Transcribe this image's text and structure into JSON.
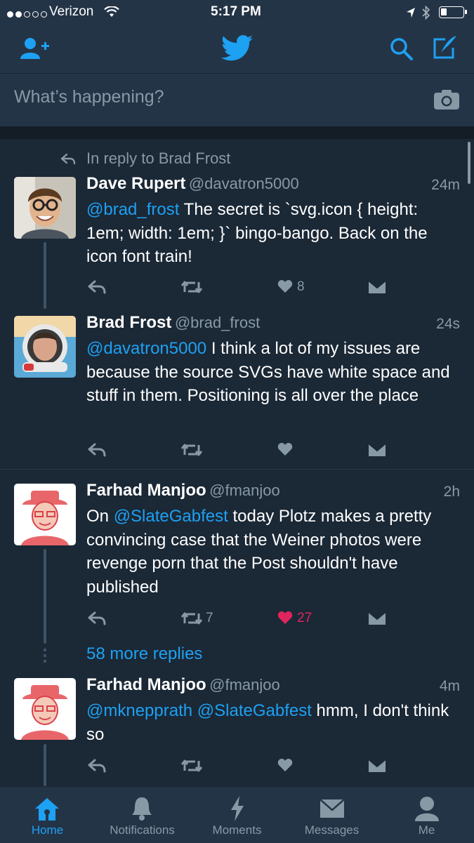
{
  "status_bar": {
    "carrier": "Verizon",
    "time": "5:17 PM"
  },
  "compose": {
    "placeholder": "What’s happening?"
  },
  "colors": {
    "accent": "#1da1f2",
    "like_active": "#e0245e",
    "background": "#1b2836",
    "chrome": "#243447"
  },
  "tweets": [
    {
      "in_reply_to": "In reply to Brad Frost",
      "name": "Dave Rupert",
      "handle": "@davatron5000",
      "time": "24m",
      "mention": "@brad_frost",
      "text": " The secret is `svg.icon { height: 1em; width: 1em; }` bingo-bango. Back on the icon font train!",
      "likes": "8",
      "retweets": ""
    },
    {
      "name": "Brad Frost",
      "handle": "@brad_frost",
      "time": "24s",
      "mention": "@davatron5000",
      "text": " I think a lot of my issues are because the source SVGs have white space and stuff in them. Positioning is all over the place",
      "likes": "",
      "retweets": ""
    },
    {
      "name": "Farhad Manjoo",
      "handle": "@fmanjoo",
      "time": "2h",
      "pre": "On ",
      "mention": "@SlateGabfest",
      "text": " today Plotz makes a pretty convincing case that the Weiner photos were revenge porn that the Post shouldn't have published",
      "likes": "27",
      "retweets": "7"
    },
    {
      "name": "Farhad Manjoo",
      "handle": "@fmanjoo",
      "time": "4m",
      "mention": "@mknepprath @SlateGabfest",
      "text": " hmm, I don't think so",
      "likes": "",
      "retweets": ""
    }
  ],
  "more_replies": "58 more replies",
  "tabs": [
    {
      "label": "Home",
      "icon": "home-icon",
      "active": true
    },
    {
      "label": "Notifications",
      "icon": "bell-icon",
      "active": false
    },
    {
      "label": "Moments",
      "icon": "lightning-icon",
      "active": false
    },
    {
      "label": "Messages",
      "icon": "envelope-icon",
      "active": false
    },
    {
      "label": "Me",
      "icon": "person-icon",
      "active": false
    }
  ]
}
